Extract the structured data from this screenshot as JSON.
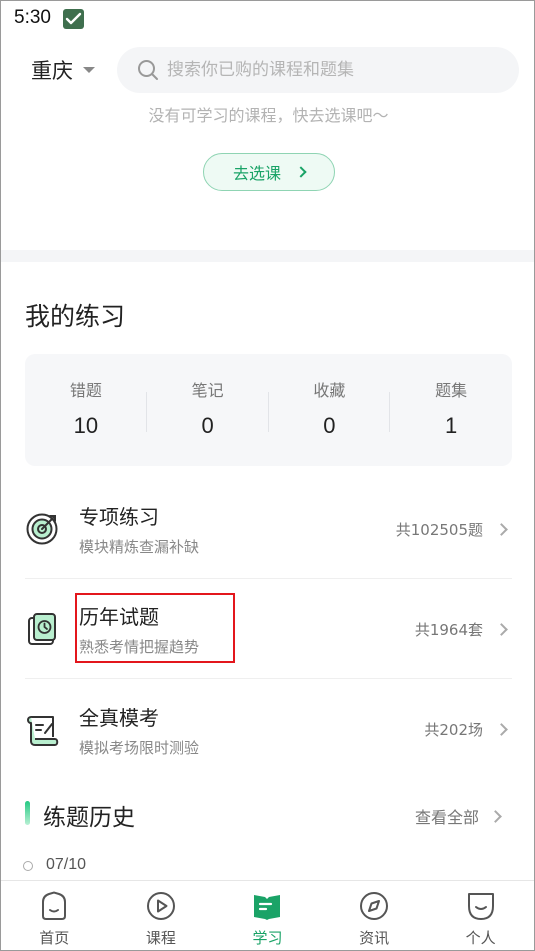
{
  "status_bar": {
    "time": "5:30"
  },
  "header": {
    "city": "重庆",
    "search_placeholder": "搜索你已购的课程和题集"
  },
  "empty_state": {
    "tip": "没有可学习的课程，快去选课吧～",
    "button_label": "去选课"
  },
  "practice": {
    "title": "我的练习",
    "stats": [
      {
        "label": "错题",
        "value": "10"
      },
      {
        "label": "笔记",
        "value": "0"
      },
      {
        "label": "收藏",
        "value": "0"
      },
      {
        "label": "题集",
        "value": "1"
      }
    ],
    "items": [
      {
        "title": "专项练习",
        "subtitle": "模块精炼查漏补缺",
        "count": "共102505题",
        "icon": "target-icon"
      },
      {
        "title": "历年试题",
        "subtitle": "熟悉考情把握趋势",
        "count": "共1964套",
        "icon": "clock-book-icon"
      },
      {
        "title": "全真模考",
        "subtitle": "模拟考场限时测验",
        "count": "共202场",
        "icon": "scroll-exam-icon"
      }
    ]
  },
  "history": {
    "title": "练题历史",
    "view_all": "查看全部",
    "entries": [
      {
        "date": "07/10"
      }
    ]
  },
  "tabs": [
    {
      "label": "首页",
      "icon": "home-icon"
    },
    {
      "label": "课程",
      "icon": "play-icon"
    },
    {
      "label": "学习",
      "icon": "book-icon",
      "active": true
    },
    {
      "label": "资讯",
      "icon": "compass-icon"
    },
    {
      "label": "个人",
      "icon": "smile-icon"
    }
  ],
  "colors": {
    "accent": "#1aa367",
    "highlight": "#e3161c"
  }
}
